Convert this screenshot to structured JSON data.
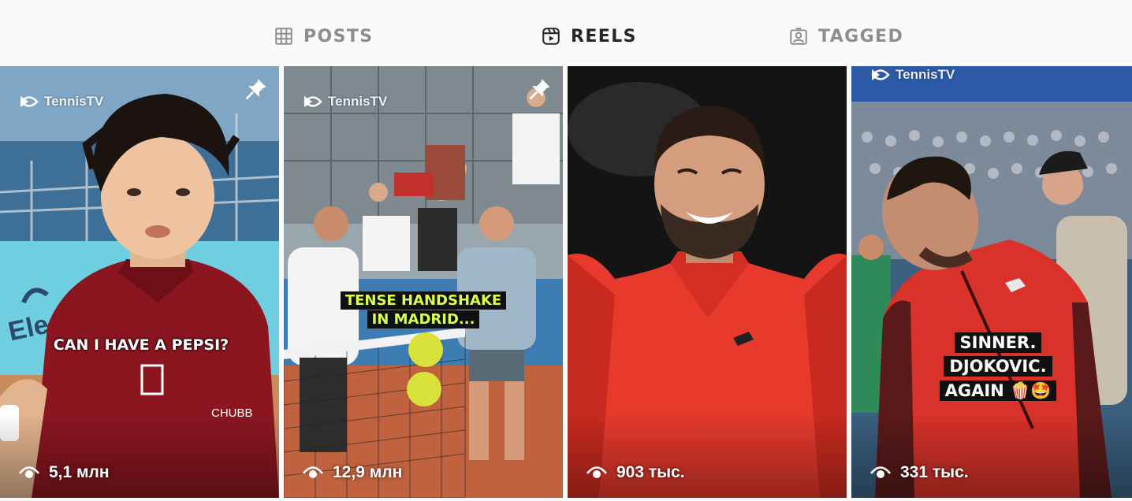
{
  "tabs": [
    {
      "label": "POSTS",
      "icon": "grid-icon",
      "active": false
    },
    {
      "label": "REELS",
      "icon": "reels-icon",
      "active": true
    },
    {
      "label": "TAGGED",
      "icon": "tagged-icon",
      "active": false
    }
  ],
  "reels": [
    {
      "caption": "CAN I HAVE A PEPSI?",
      "views": "5,1 млн",
      "pinned": true,
      "watermark": "TennisTV"
    },
    {
      "caption": "TENSE HANDSHAKE\nIN MADRID...",
      "views": "12,9 млн",
      "pinned": true,
      "watermark": "TennisTV"
    },
    {
      "caption": "",
      "views": "903 тыс.",
      "pinned": false,
      "watermark": ""
    },
    {
      "caption": "SINNER.\nDJOKOVIC.\nAGAIN 🍿🤩",
      "views": "331 тыс.",
      "pinned": false,
      "watermark": "TennisTV"
    }
  ],
  "colors": {
    "active_tab": "#262626",
    "inactive_tab": "#8e8e8e",
    "caption_highlight": "#d8ff4f"
  }
}
